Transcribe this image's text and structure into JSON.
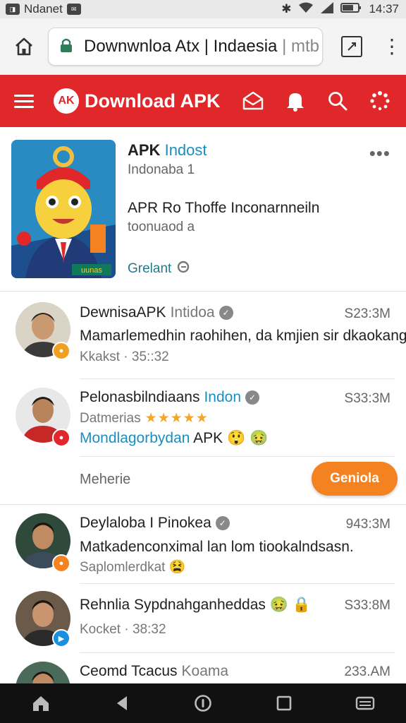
{
  "status": {
    "carrier": "Ndanet",
    "time": "14:37"
  },
  "browser": {
    "url_main": "Downwnloa Atx | Indaesia",
    "url_tail": "mtb"
  },
  "appbar": {
    "logo_text": "AK",
    "brand": "Download APK"
  },
  "app_card": {
    "title": "APK",
    "title_highlight": "Indost",
    "subtitle": "Indonaba 1",
    "description": "APR Ro Thoffe Inconarnneiln",
    "description2": "toonuaod a",
    "link": "Grelant",
    "image_label": "uunas"
  },
  "posts": [
    {
      "name": "DewnisaAPK",
      "name_extra": "Intidoa",
      "time": "S23:3M",
      "text": "Mamarlemedhin raohihen, da kmjien sir dkaokang",
      "meta": "Kkakst · 35::32",
      "badge_color": "#f0a020"
    },
    {
      "name": "Pelonasbilndiaans",
      "name_extra": "Indon",
      "time": "S33:3M",
      "meta_label": "Datmerias",
      "stars": "★★★★★",
      "text_link": "Mondlagorbydan",
      "text_tail": "APK 😲 🤢",
      "badge_color": "#e0272a"
    },
    {
      "name": "Deylaloba I Pinokea",
      "time": "943:3M",
      "text": "Matkadenconximal lan lom tiookalndsasn.",
      "meta": "Saplomlerdkat 😫",
      "badge_color": "#f58220"
    },
    {
      "name": "Rehnlia Sypdnahganheddas 🤢 🔒",
      "time": "S33:8M",
      "meta": "Kocket · 38:32",
      "badge_color": "#1a8fe0"
    },
    {
      "name": "Ceomd Tcacus",
      "name_extra": "Koama",
      "time": "233.AM"
    }
  ],
  "action_row": {
    "label": "Meherie",
    "button": "Geniola"
  },
  "icons": {
    "home": "home-icon",
    "lock": "lock-icon",
    "tabs": "tab-switcher-icon",
    "menu": "kebab-menu-icon",
    "hamburger": "hamburger-icon",
    "mail": "mail-icon",
    "bell": "bell-icon",
    "search": "search-icon",
    "loading": "loading-icon"
  },
  "colors": {
    "brand_red": "#e0272a",
    "accent_orange": "#f58220",
    "link_blue": "#1a8fbf"
  }
}
